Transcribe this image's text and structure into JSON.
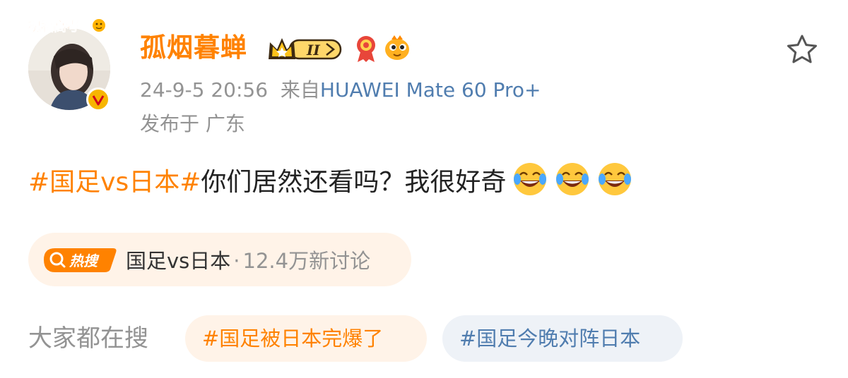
{
  "post": {
    "avatar_frame_text": "祝福高考",
    "username": "孤烟暮蝉",
    "vip_level": "II",
    "timestamp": "24-9-5 20:56",
    "source_prefix": "来自",
    "device": "HUAWEI Mate 60 Pro+",
    "location": "发布于 广东",
    "topic": "#国足vs日本#",
    "text": "你们居然还看吗？我很好奇",
    "emojis": [
      "laugh-cry-emoji",
      "laugh-cry-emoji",
      "laugh-cry-emoji"
    ]
  },
  "hot_search": {
    "tag": "热搜",
    "topic": "国足vs日本",
    "separator": "·",
    "count": "12.4万新讨论"
  },
  "everyone_search": {
    "label": "大家都在搜",
    "chips": [
      "#国足被日本完爆了",
      "#国足今晚对阵日本"
    ]
  },
  "colors": {
    "accent_orange": "#ff8200",
    "link_blue": "#507daf",
    "muted_gray": "#939393",
    "pill_orange_bg": "#fff3e8",
    "pill_blue_bg": "#eef2f7"
  },
  "icons": [
    "star-icon",
    "verified-icon",
    "crown-icon",
    "medal-icon",
    "fish-icon",
    "search-icon"
  ]
}
